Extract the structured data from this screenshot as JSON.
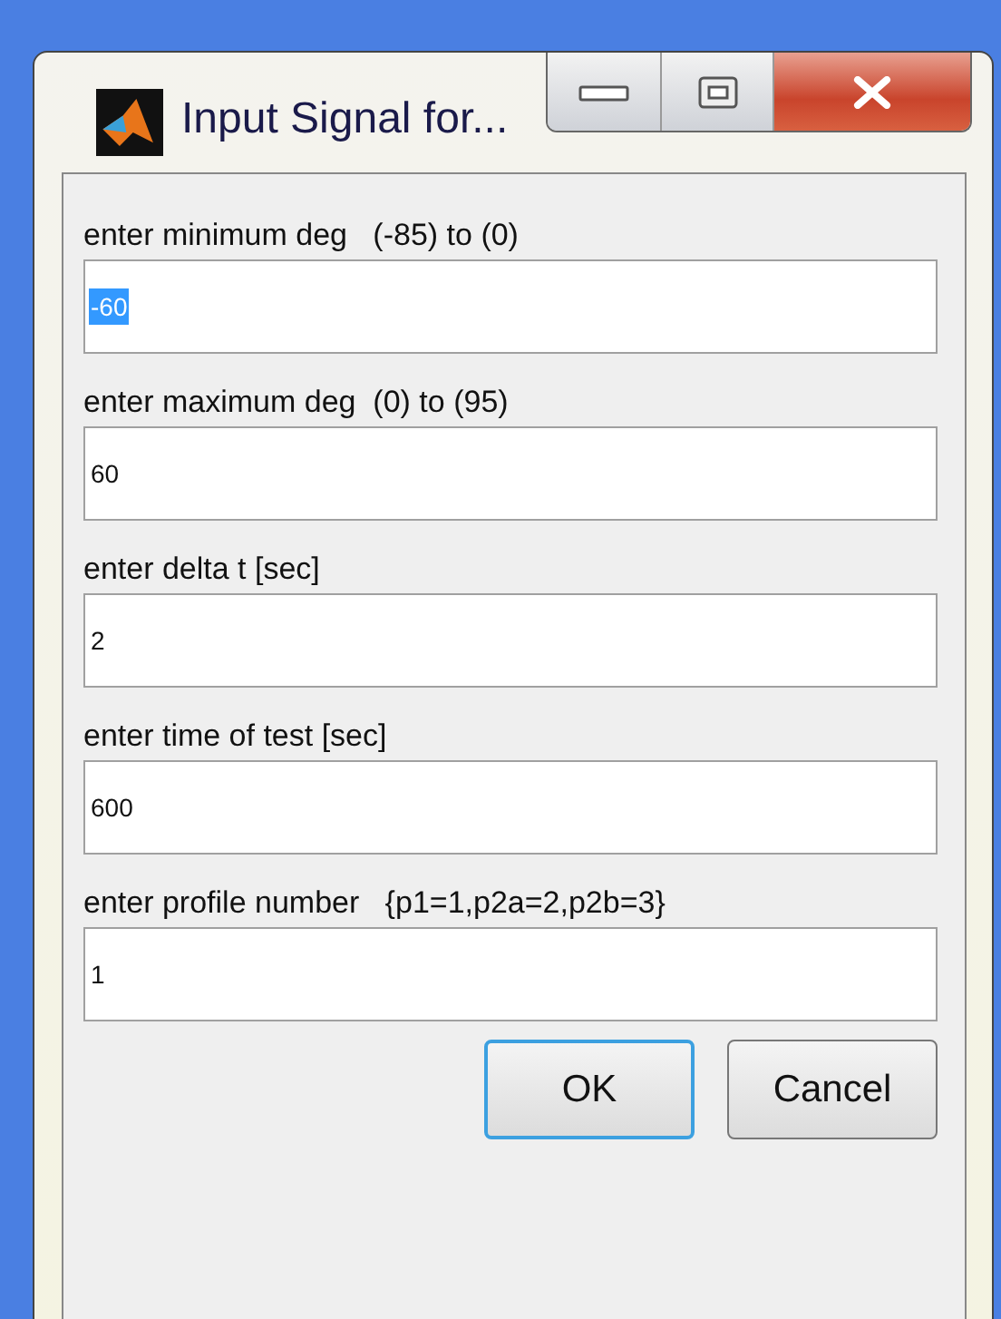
{
  "window": {
    "title": "Input Signal for..."
  },
  "fields": [
    {
      "label": "enter minimum deg   (-85) to (0)",
      "value": "-60",
      "selected": true
    },
    {
      "label": "enter maximum deg  (0) to (95)",
      "value": "60",
      "selected": false
    },
    {
      "label": "enter delta t [sec]",
      "value": "2",
      "selected": false
    },
    {
      "label": "enter time of test [sec]",
      "value": "600",
      "selected": false
    },
    {
      "label": "enter profile number   {p1=1,p2a=2,p2b=3}",
      "value": "1",
      "selected": false
    }
  ],
  "buttons": [
    {
      "label": "OK",
      "default": true
    },
    {
      "label": "Cancel",
      "default": false
    }
  ]
}
